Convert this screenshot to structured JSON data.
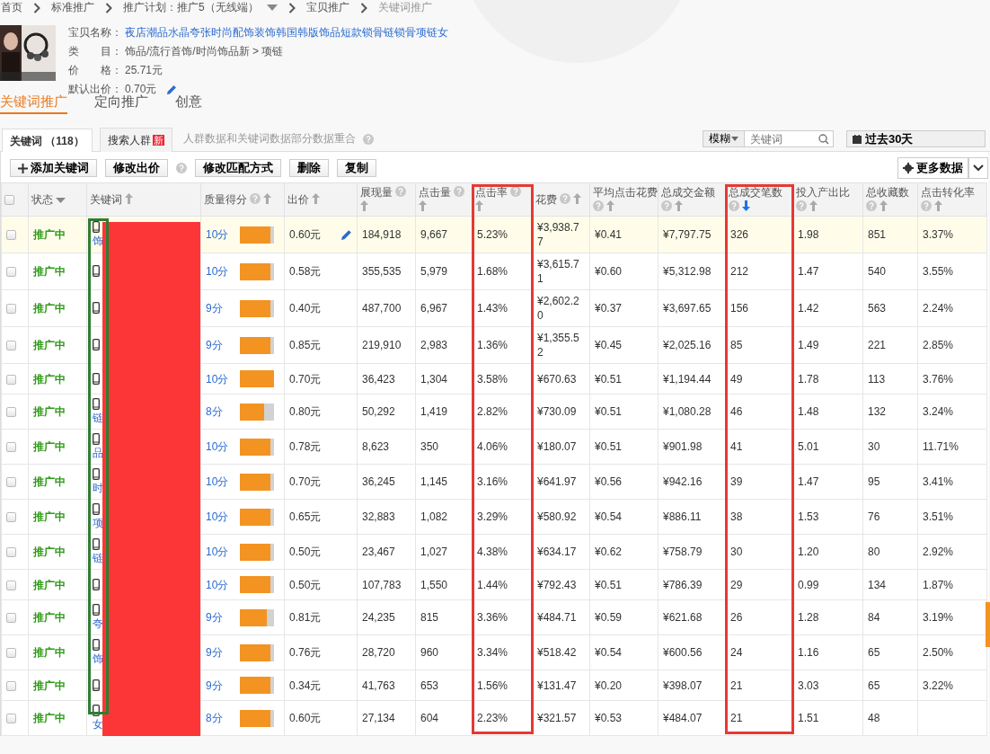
{
  "breadcrumb": [
    {
      "label": "首页",
      "current": false,
      "dropdown": false
    },
    {
      "label": "标准推广",
      "current": false,
      "dropdown": false
    },
    {
      "label": "推广计划：推广5（无线端）",
      "current": false,
      "dropdown": true
    },
    {
      "label": "宝贝推广",
      "current": false,
      "dropdown": false
    },
    {
      "label": "关键词推广",
      "current": true,
      "dropdown": false
    }
  ],
  "product": {
    "fields": [
      {
        "label": "宝贝名称：",
        "value": "夜店潮品水晶夸张时尚配饰装饰韩国韩版饰品短款锁骨链锁骨项链女",
        "kind": "link"
      },
      {
        "label": "类　　目：",
        "value": "饰品/流行首饰/时尚饰品新 > 项链",
        "kind": "text"
      },
      {
        "label": "价　　格：",
        "value": "25.71元",
        "kind": "text"
      },
      {
        "label": "默认出价：",
        "value": "0.70元",
        "kind": "editable"
      }
    ]
  },
  "main_tabs": [
    {
      "label": "关键词推广",
      "selected": true
    },
    {
      "label": "定向推广",
      "selected": false
    },
    {
      "label": "创意",
      "selected": false
    }
  ],
  "sub_tabs": [
    {
      "label": "关键词 （118）",
      "selected": true
    },
    {
      "label": "搜索人群",
      "selected": false,
      "badge": "新"
    }
  ],
  "sub_tabs_note": "人群数据和关键词数据部分数据重合",
  "filter": {
    "match_mode": "模糊",
    "placeholder": "关键词"
  },
  "date_range": "过去30天",
  "toolbar": [
    {
      "label": "添加关键词",
      "kind": "add",
      "help": false
    },
    {
      "label": "修改出价",
      "kind": "plain",
      "help": true
    },
    {
      "label": "修改匹配方式",
      "kind": "plain",
      "help": false
    },
    {
      "label": "删除",
      "kind": "plain",
      "help": false
    },
    {
      "label": "复制",
      "kind": "plain",
      "help": false
    }
  ],
  "more_data": "更多数据",
  "table": {
    "columns": [
      {
        "kind": "checkbox",
        "checked": false
      },
      {
        "label": "状态",
        "kind": "filter",
        "help": false
      },
      {
        "label": "关键词",
        "kind": "sort",
        "sorted": false,
        "help": false,
        "markups": [
          {
            "kind": "redaction"
          },
          {
            "kind": "frame",
            "color": "#2e7d32"
          }
        ]
      },
      {
        "label": "质量得分",
        "kind": "sort",
        "sorted": false,
        "help": true
      },
      {
        "label": "出价",
        "kind": "sort",
        "sorted": false,
        "help": false
      },
      {
        "label": "展现量",
        "kind": "sort",
        "sorted": false,
        "help": true
      },
      {
        "label": "点击量",
        "kind": "sort",
        "sorted": false,
        "help": true
      },
      {
        "label": "点击率",
        "kind": "sort",
        "sorted": false,
        "help": true,
        "markups": [
          {
            "kind": "frame",
            "color": "#e53935"
          }
        ]
      },
      {
        "label": "花费",
        "kind": "sort",
        "sorted": false,
        "help": true
      },
      {
        "label": "平均点击花费",
        "kind": "sort",
        "sorted": false,
        "help": true
      },
      {
        "label": "总成交金额",
        "kind": "sort",
        "sorted": false,
        "help": true
      },
      {
        "label": "总成交笔数",
        "kind": "sort",
        "sorted": true,
        "help": true,
        "markups": [
          {
            "kind": "frame",
            "color": "#e53935"
          }
        ]
      },
      {
        "label": "投入产出比",
        "kind": "sort",
        "sorted": false,
        "help": true
      },
      {
        "label": "总收藏数",
        "kind": "sort",
        "sorted": false,
        "help": true
      },
      {
        "label": "点击转化率",
        "kind": "sort",
        "sorted": false,
        "help": true
      }
    ],
    "rows": [
      {
        "checked": false,
        "hovered": true,
        "status": "推广中",
        "keyword": "饰",
        "score": "10分",
        "level": 0.9,
        "bid": "0.60元",
        "impressions": "184,918",
        "clicks": "9,667",
        "ctr": "5.23%",
        "spend": "¥3,938.77",
        "cpc": "¥0.41",
        "revenue": "¥7,797.75",
        "orders": "326",
        "roi": "1.98",
        "favorites": "851",
        "cvr": "3.37%"
      },
      {
        "checked": false,
        "hovered": false,
        "status": "推广中",
        "score": "10分",
        "level": 0.9,
        "bid": "0.58元",
        "impressions": "355,535",
        "clicks": "5,979",
        "ctr": "1.68%",
        "spend": "¥3,615.71",
        "cpc": "¥0.60",
        "revenue": "¥5,312.98",
        "orders": "212",
        "roi": "1.47",
        "favorites": "540",
        "cvr": "3.55%"
      },
      {
        "checked": false,
        "hovered": false,
        "status": "推广中",
        "score": "9分",
        "level": 0.9,
        "bid": "0.40元",
        "impressions": "487,700",
        "clicks": "6,967",
        "ctr": "1.43%",
        "spend": "¥2,602.20",
        "cpc": "¥0.37",
        "revenue": "¥3,697.65",
        "orders": "156",
        "roi": "1.42",
        "favorites": "563",
        "cvr": "2.24%"
      },
      {
        "checked": false,
        "hovered": false,
        "status": "推广中",
        "score": "9分",
        "level": 0.9,
        "bid": "0.85元",
        "impressions": "219,910",
        "clicks": "2,983",
        "ctr": "1.36%",
        "spend": "¥1,355.52",
        "cpc": "¥0.45",
        "revenue": "¥2,025.16",
        "orders": "85",
        "roi": "1.49",
        "favorites": "221",
        "cvr": "2.85%"
      },
      {
        "checked": false,
        "hovered": false,
        "status": "推广中",
        "score": "10分",
        "level": 1,
        "bid": "0.70元",
        "impressions": "36,423",
        "clicks": "1,304",
        "ctr": "3.58%",
        "spend": "¥670.63",
        "cpc": "¥0.51",
        "revenue": "¥1,194.44",
        "orders": "49",
        "roi": "1.78",
        "favorites": "113",
        "cvr": "3.76%"
      },
      {
        "checked": false,
        "hovered": false,
        "status": "推广中",
        "keyword": "链",
        "score": "8分",
        "level": 0.7,
        "bid": "0.80元",
        "impressions": "50,292",
        "clicks": "1,419",
        "ctr": "2.82%",
        "spend": "¥730.09",
        "cpc": "¥0.51",
        "revenue": "¥1,080.28",
        "orders": "46",
        "roi": "1.48",
        "favorites": "132",
        "cvr": "3.24%"
      },
      {
        "checked": false,
        "hovered": false,
        "status": "推广中",
        "keyword": "品",
        "score": "10分",
        "level": 0.9,
        "bid": "0.78元",
        "impressions": "8,623",
        "clicks": "350",
        "ctr": "4.06%",
        "spend": "¥180.07",
        "cpc": "¥0.51",
        "revenue": "¥901.98",
        "orders": "41",
        "roi": "5.01",
        "favorites": "30",
        "cvr": "11.71%"
      },
      {
        "checked": false,
        "hovered": false,
        "status": "推广中",
        "keyword": "时",
        "score": "10分",
        "level": 0.9,
        "bid": "0.70元",
        "impressions": "36,245",
        "clicks": "1,145",
        "ctr": "3.16%",
        "spend": "¥641.97",
        "cpc": "¥0.56",
        "revenue": "¥942.16",
        "orders": "39",
        "roi": "1.47",
        "favorites": "95",
        "cvr": "3.41%"
      },
      {
        "checked": false,
        "hovered": false,
        "status": "推广中",
        "keyword": "项",
        "score": "10分",
        "level": 0.9,
        "bid": "0.65元",
        "impressions": "32,883",
        "clicks": "1,082",
        "ctr": "3.29%",
        "spend": "¥580.92",
        "cpc": "¥0.54",
        "revenue": "¥886.11",
        "orders": "38",
        "roi": "1.53",
        "favorites": "76",
        "cvr": "3.51%"
      },
      {
        "checked": false,
        "hovered": false,
        "status": "推广中",
        "keyword": "链",
        "score": "10分",
        "level": 0.9,
        "bid": "0.50元",
        "impressions": "23,467",
        "clicks": "1,027",
        "ctr": "4.38%",
        "spend": "¥634.17",
        "cpc": "¥0.62",
        "revenue": "¥758.79",
        "orders": "30",
        "roi": "1.20",
        "favorites": "80",
        "cvr": "2.92%"
      },
      {
        "checked": false,
        "hovered": false,
        "status": "推广中",
        "score": "10分",
        "level": 0.9,
        "bid": "0.50元",
        "impressions": "107,783",
        "clicks": "1,550",
        "ctr": "1.44%",
        "spend": "¥792.43",
        "cpc": "¥0.51",
        "revenue": "¥786.39",
        "orders": "29",
        "roi": "0.99",
        "favorites": "134",
        "cvr": "1.87%"
      },
      {
        "checked": false,
        "hovered": false,
        "status": "推广中",
        "keyword": "夸",
        "score": "9分",
        "level": 0.8,
        "bid": "0.81元",
        "impressions": "24,235",
        "clicks": "815",
        "ctr": "3.36%",
        "spend": "¥484.71",
        "cpc": "¥0.59",
        "revenue": "¥621.68",
        "orders": "26",
        "roi": "1.28",
        "favorites": "84",
        "cvr": "3.19%"
      },
      {
        "checked": false,
        "hovered": false,
        "status": "推广中",
        "keyword": "饰",
        "score": "9分",
        "level": 0.9,
        "bid": "0.76元",
        "impressions": "28,720",
        "clicks": "960",
        "ctr": "3.34%",
        "spend": "¥518.42",
        "cpc": "¥0.54",
        "revenue": "¥600.56",
        "orders": "24",
        "roi": "1.16",
        "favorites": "65",
        "cvr": "2.50%"
      },
      {
        "checked": false,
        "hovered": false,
        "status": "推广中",
        "score": "9分",
        "level": 0.9,
        "bid": "0.34元",
        "impressions": "41,763",
        "clicks": "653",
        "ctr": "1.56%",
        "spend": "¥131.47",
        "cpc": "¥0.20",
        "revenue": "¥398.07",
        "orders": "21",
        "roi": "3.03",
        "favorites": "65",
        "cvr": "3.22%"
      },
      {
        "checked": false,
        "hovered": false,
        "status": "推广中",
        "keyword": "女",
        "score": "8分",
        "level": 0.9,
        "bid": "0.60元",
        "impressions": "27,134",
        "clicks": "604",
        "ctr": "2.23%",
        "spend": "¥321.57",
        "cpc": "¥0.53",
        "revenue": "¥484.07",
        "orders": "21",
        "roi": "1.51",
        "favorites": "48"
      }
    ]
  }
}
